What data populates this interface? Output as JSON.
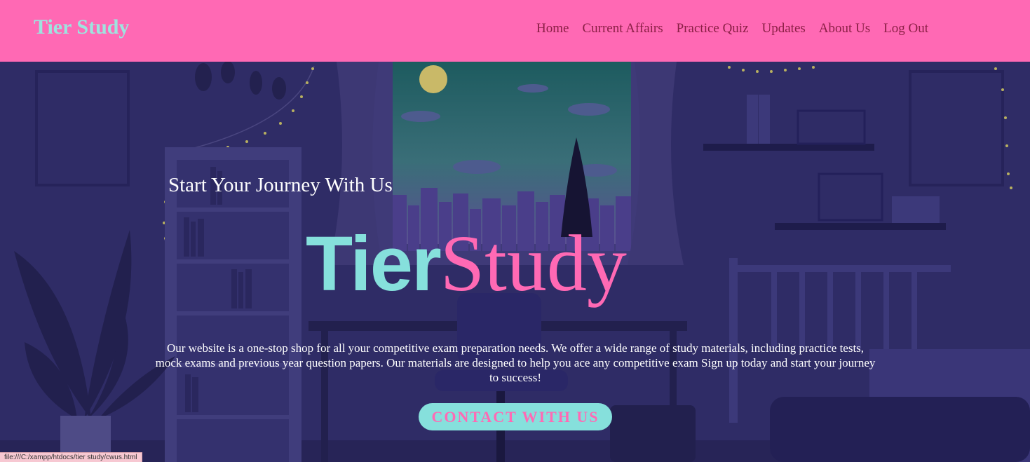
{
  "navbar": {
    "brand": "Tier Study",
    "links": [
      "Home",
      "Current Affairs",
      "Practice Quiz",
      "Updates",
      "About Us",
      "Log Out"
    ]
  },
  "hero": {
    "tagline": "Start Your Journey With Us",
    "title_part1": "Tier",
    "title_part2": "Study",
    "description": "Our website is a one-stop shop for all your competitive exam preparation needs. We offer a wide range of study materials, including practice tests, mock exams and previous year question papers. Our materials are designed to help you ace any competitive exam Sign up today and start your journey to success!",
    "cta_label": "CONTACT WITH US"
  },
  "status_bar": {
    "url": "file:///C:/xampp/htdocs/tier study/cwus.html"
  },
  "colors": {
    "nav_bg": "#ff69b4",
    "brand": "#9ee3df",
    "nav_link": "#8a1f45",
    "accent_teal": "#86e0dc",
    "accent_pink": "#ff69b4",
    "hero_bg": "#2e2b63"
  }
}
